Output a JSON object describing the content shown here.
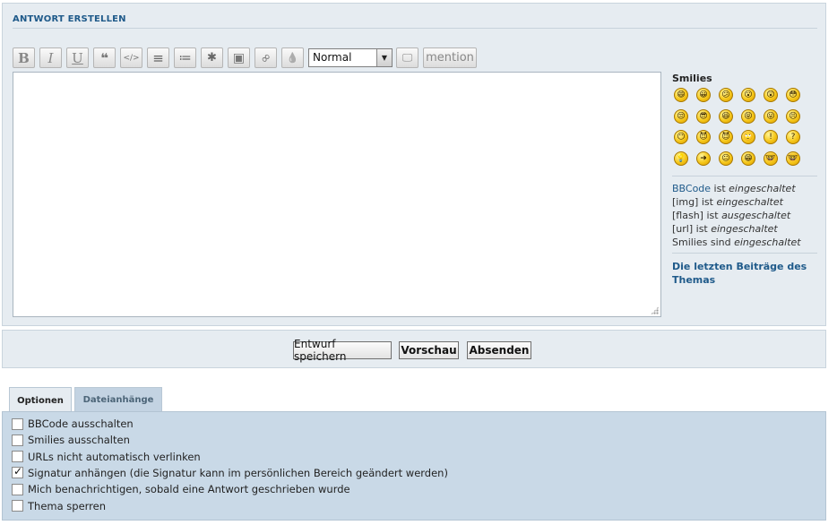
{
  "panel": {
    "title": "ANTWORT ERSTELLEN"
  },
  "toolbar": {
    "buttons": [
      {
        "name": "bold",
        "glyph": "B"
      },
      {
        "name": "italic",
        "glyph": "I"
      },
      {
        "name": "underline",
        "glyph": "U"
      },
      {
        "name": "quote",
        "glyph": "❝"
      },
      {
        "name": "code",
        "glyph": "</>"
      },
      {
        "name": "list",
        "glyph": "≡"
      },
      {
        "name": "list-numbered",
        "glyph": "≔"
      },
      {
        "name": "list-item",
        "glyph": "✱"
      },
      {
        "name": "image",
        "glyph": "▣"
      },
      {
        "name": "link",
        "glyph": "∞"
      },
      {
        "name": "color",
        "glyph": "💧"
      }
    ],
    "font_size_select": "Normal",
    "mention_label": "mention"
  },
  "side": {
    "smilies_title": "Smilies",
    "smilies": [
      "😄",
      "😀",
      "😕",
      "😮",
      "😲",
      "😳",
      "😒",
      "😎",
      "😆",
      "😝",
      "😛",
      "😣",
      "😶",
      "😈",
      "😈",
      "🙄",
      "!",
      "?",
      "💡",
      "➜",
      "😐",
      "😁",
      "🤓",
      "🤓"
    ],
    "status": [
      {
        "pre": "BBCode",
        "mid": " ist ",
        "val": "eingeschaltet"
      },
      {
        "pre": "[img]",
        "mid": " ist ",
        "val": "eingeschaltet"
      },
      {
        "pre": "[flash]",
        "mid": " ist ",
        "val": "ausgeschaltet"
      },
      {
        "pre": "[url]",
        "mid": " ist ",
        "val": "eingeschaltet"
      },
      {
        "pre": "Smilies",
        "mid": " sind ",
        "val": "eingeschaltet"
      }
    ],
    "recent_link": "Die letzten Beiträge des Themas"
  },
  "buttons": {
    "draft": "Entwurf speichern",
    "preview": "Vorschau",
    "submit": "Absenden"
  },
  "tabs": {
    "options": "Optionen",
    "attachments": "Dateianhänge"
  },
  "options": [
    {
      "label": "BBCode ausschalten",
      "checked": false
    },
    {
      "label": "Smilies ausschalten",
      "checked": false
    },
    {
      "label": "URLs nicht automatisch verlinken",
      "checked": false
    },
    {
      "label": "Signatur anhängen (die Signatur kann im persönlichen Bereich geändert werden)",
      "checked": true
    },
    {
      "label": "Mich benachrichtigen, sobald eine Antwort geschrieben wurde",
      "checked": false
    },
    {
      "label": "Thema sperren",
      "checked": false
    }
  ]
}
